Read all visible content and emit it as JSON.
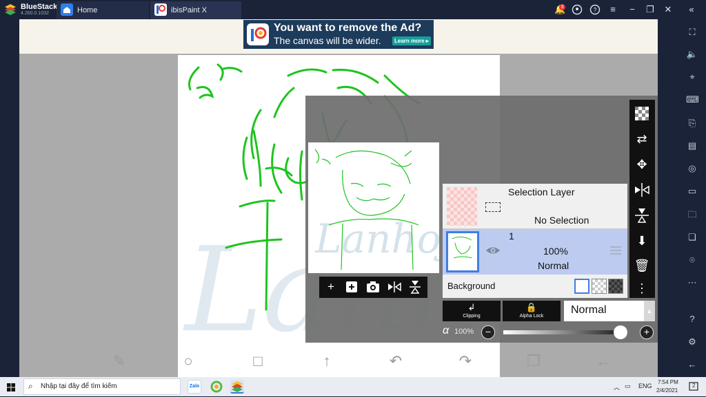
{
  "window": {
    "app_name": "BlueStacks",
    "version": "4.260.0.1032",
    "tabs": [
      {
        "label": "Home",
        "icon": "home-icon"
      },
      {
        "label": "ibisPaint X",
        "icon": "ibispaint-icon"
      }
    ],
    "notification_count": "3",
    "top_icons": [
      "bell-icon",
      "account-icon",
      "help-icon",
      "menu-icon",
      "minimize-icon",
      "restore-icon",
      "close-icon",
      "collapse-sidebar-icon"
    ]
  },
  "ad": {
    "line1": "You want to remove the Ad?",
    "line2": "The canvas will be wider.",
    "cta": "Learn more ▸"
  },
  "canvas": {
    "watermark": "Lanhoji",
    "stroke_color": "#1ec41e"
  },
  "layers": {
    "selection_layer": {
      "name": "Selection Layer",
      "status": "No Selection"
    },
    "layer1": {
      "number": "1",
      "opacity": "100%",
      "blend": "Normal"
    },
    "background": {
      "label": "Background"
    }
  },
  "blend": {
    "clipping_label": "Clipping",
    "alpha_lock_label": "Alpha Lock",
    "mode": "Normal",
    "opacity_symbol": "α",
    "opacity_value": "100%",
    "opacity_fraction": 1.0
  },
  "panel_toolbar_icons": [
    "transparency-icon",
    "move-layer-icon",
    "move-icon",
    "flip-horizontal-icon",
    "flip-vertical-icon",
    "merge-down-icon",
    "delete-icon",
    "more-options-icon"
  ],
  "preview_toolbar_icons": [
    "add-layer-icon",
    "add-special-layer-icon",
    "camera-icon",
    "flip-h-icon",
    "flip-v-icon"
  ],
  "bottom_toolbar_icons": [
    "tools-icon",
    "brush-color-icon",
    "layers-square-icon",
    "upload-icon",
    "undo-icon",
    "redo-icon",
    "layers-panel-icon",
    "back-icon"
  ],
  "sidebar_icons": [
    "fullscreen-icon",
    "volume-icon",
    "pointer-icon",
    "keyboard-icon",
    "install-apk-icon",
    "macro-icon",
    "screenshot-icon",
    "record-icon",
    "folder-icon",
    "multi-instance-icon",
    "location-icon",
    "more-icon",
    "help-icon",
    "settings-icon",
    "back-icon"
  ],
  "taskbar": {
    "search_placeholder": "Nhập tại đây để tìm kiếm",
    "language": "ENG",
    "time": "7:54 PM",
    "date": "2/4/2021",
    "notification_count": "2"
  },
  "colors": {
    "accent": "#4a7fd8",
    "stroke_green": "#1ec41e",
    "topbar": "#1b2339",
    "selected_layer": "#bccbef"
  }
}
